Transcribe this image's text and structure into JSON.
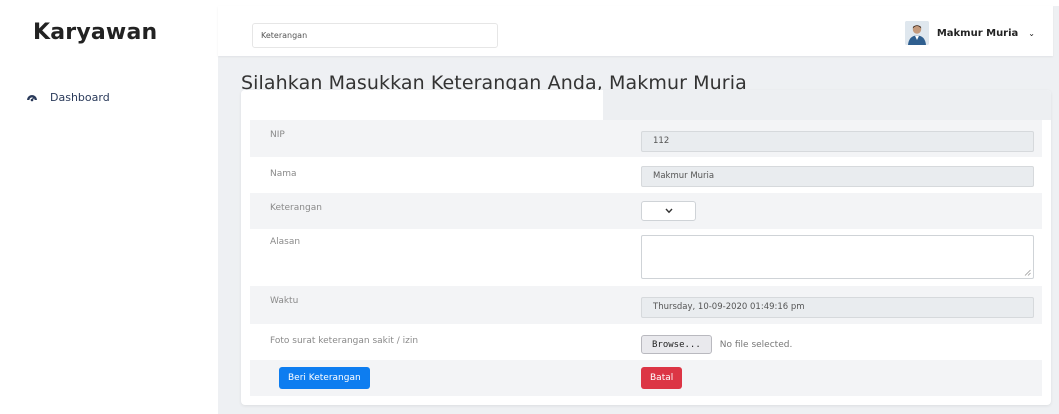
{
  "sidebar": {
    "brand": "Karyawan",
    "items": [
      {
        "label": "Dashboard",
        "icon": "dashboard-icon"
      }
    ]
  },
  "topbar": {
    "search_value": "Keterangan",
    "user_name": "Makmur Muria",
    "user_menu_chevron": "⌄"
  },
  "page": {
    "title": "Silahkan Masukkan Keterangan Anda, Makmur Muria"
  },
  "form": {
    "nip": {
      "label": "NIP",
      "value": "112"
    },
    "nama": {
      "label": "Nama",
      "value": "Makmur Muria"
    },
    "keterangan": {
      "label": "Keterangan",
      "selected": ""
    },
    "alasan": {
      "label": "Alasan",
      "value": ""
    },
    "waktu": {
      "label": "Waktu",
      "value": "Thursday, 10-09-2020 01:49:16 pm"
    },
    "foto": {
      "label": "Foto surat keterangan sakit / izin",
      "browse_label": "Browse...",
      "status": "No file selected."
    },
    "submit_label": "Beri Keterangan",
    "cancel_label": "Batal"
  },
  "colors": {
    "primary": "#0d7df0",
    "danger": "#dc3545",
    "nav_text": "#2a3a5a"
  }
}
